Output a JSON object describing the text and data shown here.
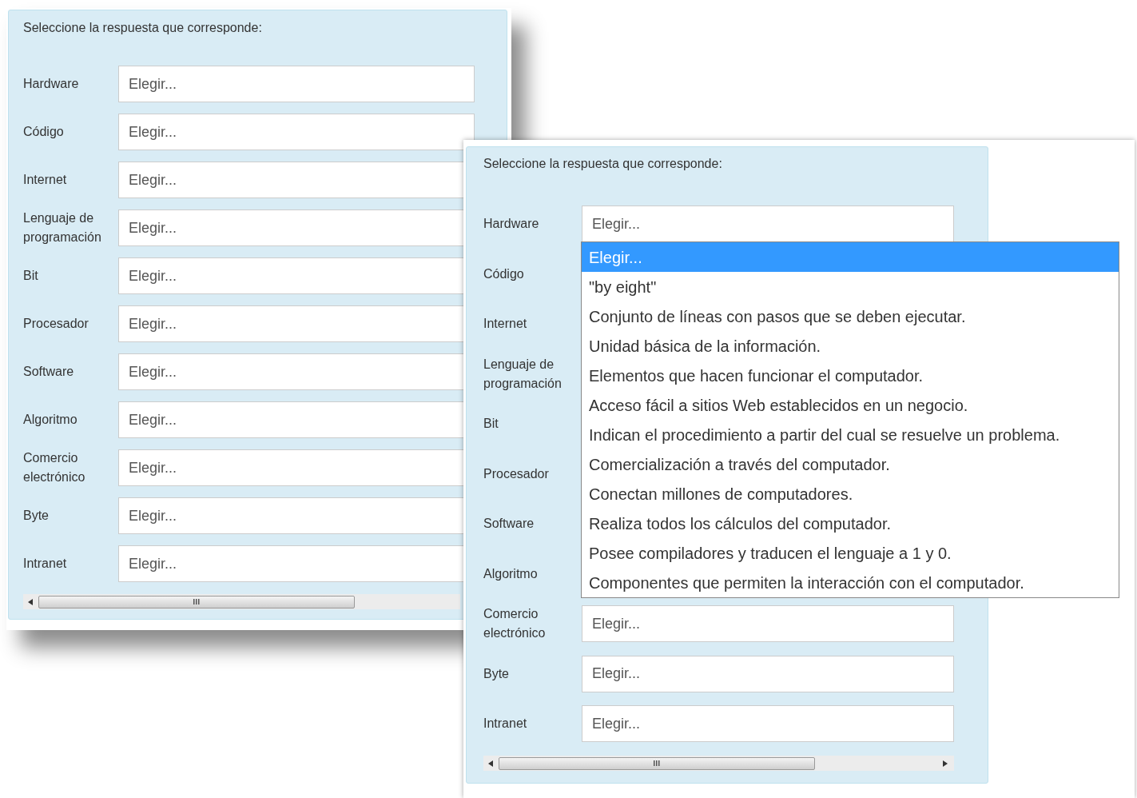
{
  "windows": [
    {
      "prompt": "Seleccione la respuesta que corresponde:",
      "rows": [
        {
          "label": "Hardware",
          "value": "Elegir..."
        },
        {
          "label": "Código",
          "value": "Elegir..."
        },
        {
          "label": "Internet",
          "value": "Elegir..."
        },
        {
          "label": "Lenguaje de programación",
          "value": "Elegir..."
        },
        {
          "label": "Bit",
          "value": "Elegir..."
        },
        {
          "label": "Procesador",
          "value": "Elegir..."
        },
        {
          "label": "Software",
          "value": "Elegir..."
        },
        {
          "label": "Algoritmo",
          "value": "Elegir..."
        },
        {
          "label": "Comercio electrónico",
          "value": "Elegir..."
        },
        {
          "label": "Byte",
          "value": "Elegir..."
        },
        {
          "label": "Intranet",
          "value": "Elegir..."
        }
      ]
    },
    {
      "prompt": "Seleccione la respuesta que corresponde:",
      "rows": [
        {
          "label": "Hardware",
          "value": "Elegir...",
          "options": [
            {
              "text": "Elegir...",
              "selected": true
            },
            {
              "text": "\"by eight\"",
              "selected": false
            },
            {
              "text": "Conjunto de líneas con pasos que se deben ejecutar.",
              "selected": false
            },
            {
              "text": "Unidad básica de la información.",
              "selected": false
            },
            {
              "text": "Elementos que hacen funcionar el computador.",
              "selected": false
            },
            {
              "text": "Acceso fácil a sitios Web establecidos en un negocio.",
              "selected": false
            },
            {
              "text": "Indican el procedimiento a partir del cual se resuelve un problema.",
              "selected": false
            },
            {
              "text": "Comercialización a través del computador.",
              "selected": false
            },
            {
              "text": "Conectan millones de computadores.",
              "selected": false
            },
            {
              "text": "Realiza todos los cálculos del computador.",
              "selected": false
            },
            {
              "text": "Posee compiladores y traducen el lenguaje a 1 y 0.",
              "selected": false
            },
            {
              "text": "Componentes que permiten la interacción con el computador.",
              "selected": false
            }
          ]
        },
        {
          "label": "Código"
        },
        {
          "label": "Internet"
        },
        {
          "label": "Lenguaje de programación"
        },
        {
          "label": "Bit"
        },
        {
          "label": "Procesador"
        },
        {
          "label": "Software"
        },
        {
          "label": "Algoritmo"
        },
        {
          "label": "Comercio electrónico",
          "value": "Elegir..."
        },
        {
          "label": "Byte",
          "value": "Elegir..."
        },
        {
          "label": "Intranet",
          "value": "Elegir..."
        }
      ]
    }
  ]
}
